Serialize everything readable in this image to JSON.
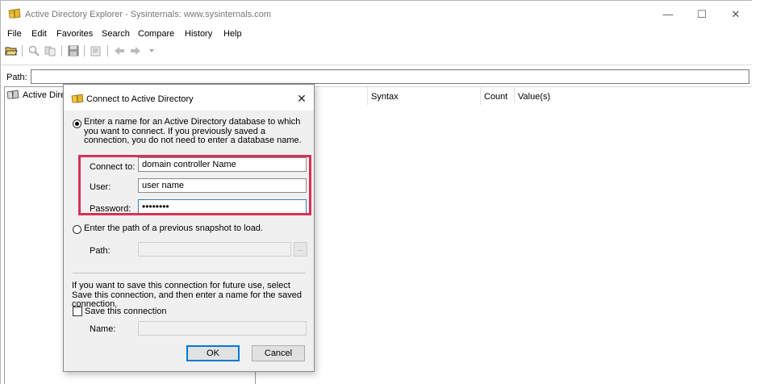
{
  "window": {
    "title": "Active Directory Explorer - Sysinternals: www.sysinternals.com",
    "controls": {
      "minimize": "—",
      "maximize": "☐",
      "close": "✕"
    }
  },
  "menu": [
    "File",
    "Edit",
    "Favorites",
    "Search",
    "Compare",
    "History",
    "Help"
  ],
  "toolbar_icons": [
    "open-folder-icon",
    "search-icon",
    "compare-icon",
    "save-icon",
    "properties-icon",
    "back-arrow-icon",
    "forward-arrow-icon",
    "dropdown-arrow-icon"
  ],
  "path": {
    "label": "Path:",
    "value": ""
  },
  "tree": {
    "root_label": "Active Direc"
  },
  "list": {
    "columns": [
      "Syntax",
      "Count",
      "Value(s)"
    ]
  },
  "dialog": {
    "title": "Connect to Active Directory",
    "close_glyph": "✕",
    "option_connect": "Enter a name for an Active Directory database to which you want to connect. If you previously saved a connection, you do not need to enter a database name.",
    "connect_to_label": "Connect to:",
    "connect_to_value": "domain controller Name",
    "user_label": "User:",
    "user_value": "user name",
    "password_label": "Password:",
    "password_value": "••••••••",
    "option_snapshot": "Enter the path of a previous snapshot to load.",
    "snapshot_path_label": "Path:",
    "snapshot_path_value": "",
    "browse_label": "...",
    "save_info": "If you want to save this connection for future use, select Save this connection, and then enter a name for the saved connection.",
    "save_checkbox_label": "Save this connection",
    "name_label": "Name:",
    "name_value": "",
    "ok_label": "OK",
    "cancel_label": "Cancel",
    "highlight_color": "#d8305a"
  }
}
